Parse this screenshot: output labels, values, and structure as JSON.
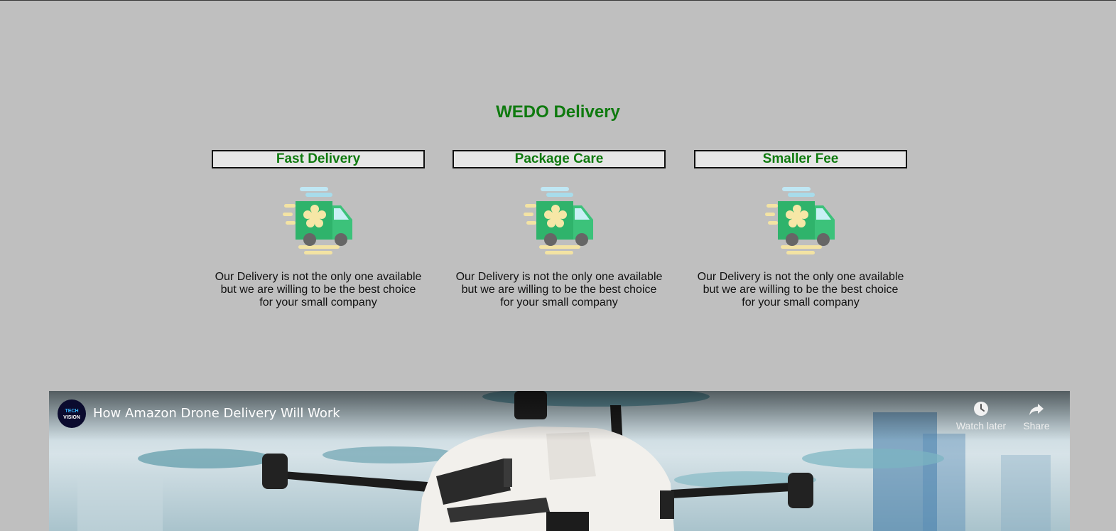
{
  "page": {
    "title": "WEDO Delivery",
    "accent_color": "#0f7a0f",
    "background_color": "#bfbfbf"
  },
  "features": [
    {
      "heading": "Fast Delivery",
      "icon": "delivery-van-icon",
      "text": "Our Delivery is not the only one available but we are willing to be the best choice for your small company"
    },
    {
      "heading": "Package Care",
      "icon": "delivery-van-icon",
      "text": "Our Delivery is not the only one available but we are willing to be the best choice for your small company"
    },
    {
      "heading": "Smaller Fee",
      "icon": "delivery-van-icon",
      "text": "Our Delivery is not the only one available but we are willing to be the best choice for your small company"
    }
  ],
  "video": {
    "title": "How Amazon Drone Delivery Will Work",
    "channel_avatar": {
      "line1": "TECH",
      "line2": "VISION"
    },
    "watch_later_label": "Watch later",
    "share_label": "Share"
  }
}
